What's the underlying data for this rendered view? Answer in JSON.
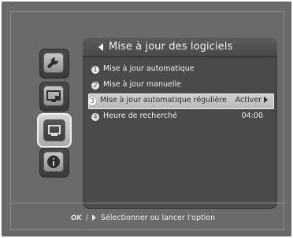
{
  "panel": {
    "title": "Mise à jour des logiciels",
    "items": [
      {
        "number": "1",
        "label": "Mise à jour automatique",
        "value": ""
      },
      {
        "number": "2",
        "label": "Mise à jour manuelle",
        "value": ""
      },
      {
        "number": "3",
        "label": "Mise à jour automatique régulière",
        "value": "Activer"
      },
      {
        "number": "4",
        "label": "Heure de recherché",
        "value": "04:00"
      }
    ],
    "selected_index": 2
  },
  "categories": [
    {
      "icon": "wrench-icon",
      "selected": false
    },
    {
      "icon": "tv-monitor-icon",
      "selected": false
    },
    {
      "icon": "screen-icon",
      "selected": true
    },
    {
      "icon": "info-icon",
      "selected": false
    }
  ],
  "footer": {
    "ok_label": "OK",
    "slash": "/",
    "hint": "Sélectionner ou lancer l'option"
  },
  "colors": {
    "background": "#6a6a6a",
    "panel": "#4a4a4a",
    "highlight": "#c5c5c5",
    "text": "#efefef"
  }
}
